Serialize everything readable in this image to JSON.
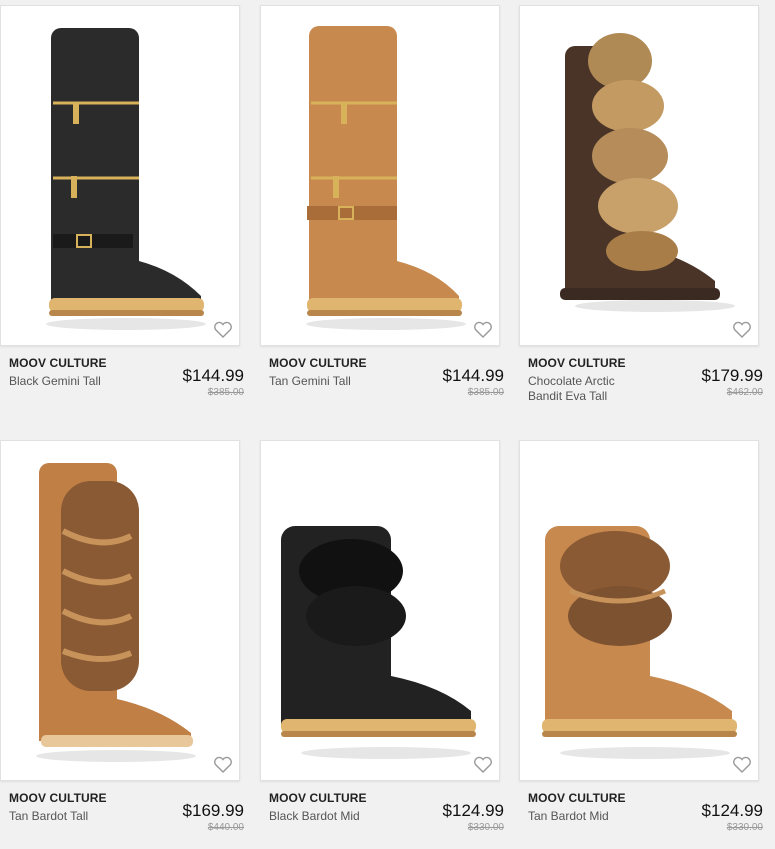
{
  "products": [
    {
      "brand": "MOOV CULTURE",
      "name": "Black Gemini Tall",
      "price": "$144.99",
      "original_price": "$385.00",
      "color": "#2b2b2b",
      "style": "tall-zip",
      "favorited": false
    },
    {
      "brand": "MOOV CULTURE",
      "name": "Tan Gemini Tall",
      "price": "$144.99",
      "original_price": "$385.00",
      "color": "#c8894f",
      "style": "tall-zip",
      "favorited": false
    },
    {
      "brand": "MOOV CULTURE",
      "name": "Chocolate Arctic Bandit Eva Tall",
      "price": "$179.99",
      "original_price": "$462.00",
      "color": "#4a3428",
      "style": "tall-fur",
      "favorited": false
    },
    {
      "brand": "MOOV CULTURE",
      "name": "Tan Bardot Tall",
      "price": "$169.99",
      "original_price": "$440.00",
      "color": "#c07f45",
      "style": "tall-fur-braid",
      "favorited": false
    },
    {
      "brand": "MOOV CULTURE",
      "name": "Black Bardot Mid",
      "price": "$124.99",
      "original_price": "$330.00",
      "color": "#222222",
      "style": "mid-fur",
      "favorited": false
    },
    {
      "brand": "MOOV CULTURE",
      "name": "Tan Bardot Mid",
      "price": "$124.99",
      "original_price": "$330.00",
      "color": "#c8894f",
      "style": "mid-fur",
      "favorited": false
    }
  ]
}
